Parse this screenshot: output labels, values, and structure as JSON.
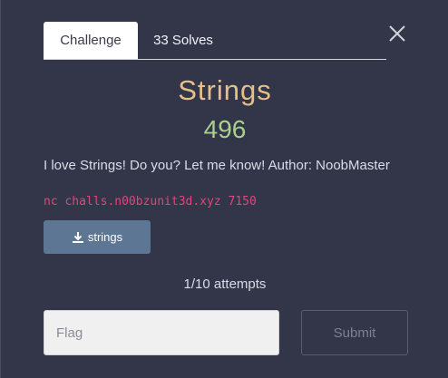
{
  "tabs": [
    {
      "label": "Challenge",
      "active": true
    },
    {
      "label": "33 Solves",
      "active": false
    }
  ],
  "close_icon": "close-icon",
  "challenge": {
    "name": "Strings",
    "points": "496",
    "description": "I love Strings! Do you? Let me know! Author: NoobMaster",
    "connection": "nc challs.n00bzunit3d.xyz 7150",
    "file": {
      "label": "strings",
      "icon": "download-icon"
    },
    "attempts": "1/10 attempts"
  },
  "form": {
    "flag_placeholder": "Flag",
    "submit_label": "Submit"
  },
  "colors": {
    "background": "#333548",
    "title": "#e6c089",
    "points": "#a9d08e",
    "code": "#e0467c",
    "file_button": "#5c7694"
  }
}
